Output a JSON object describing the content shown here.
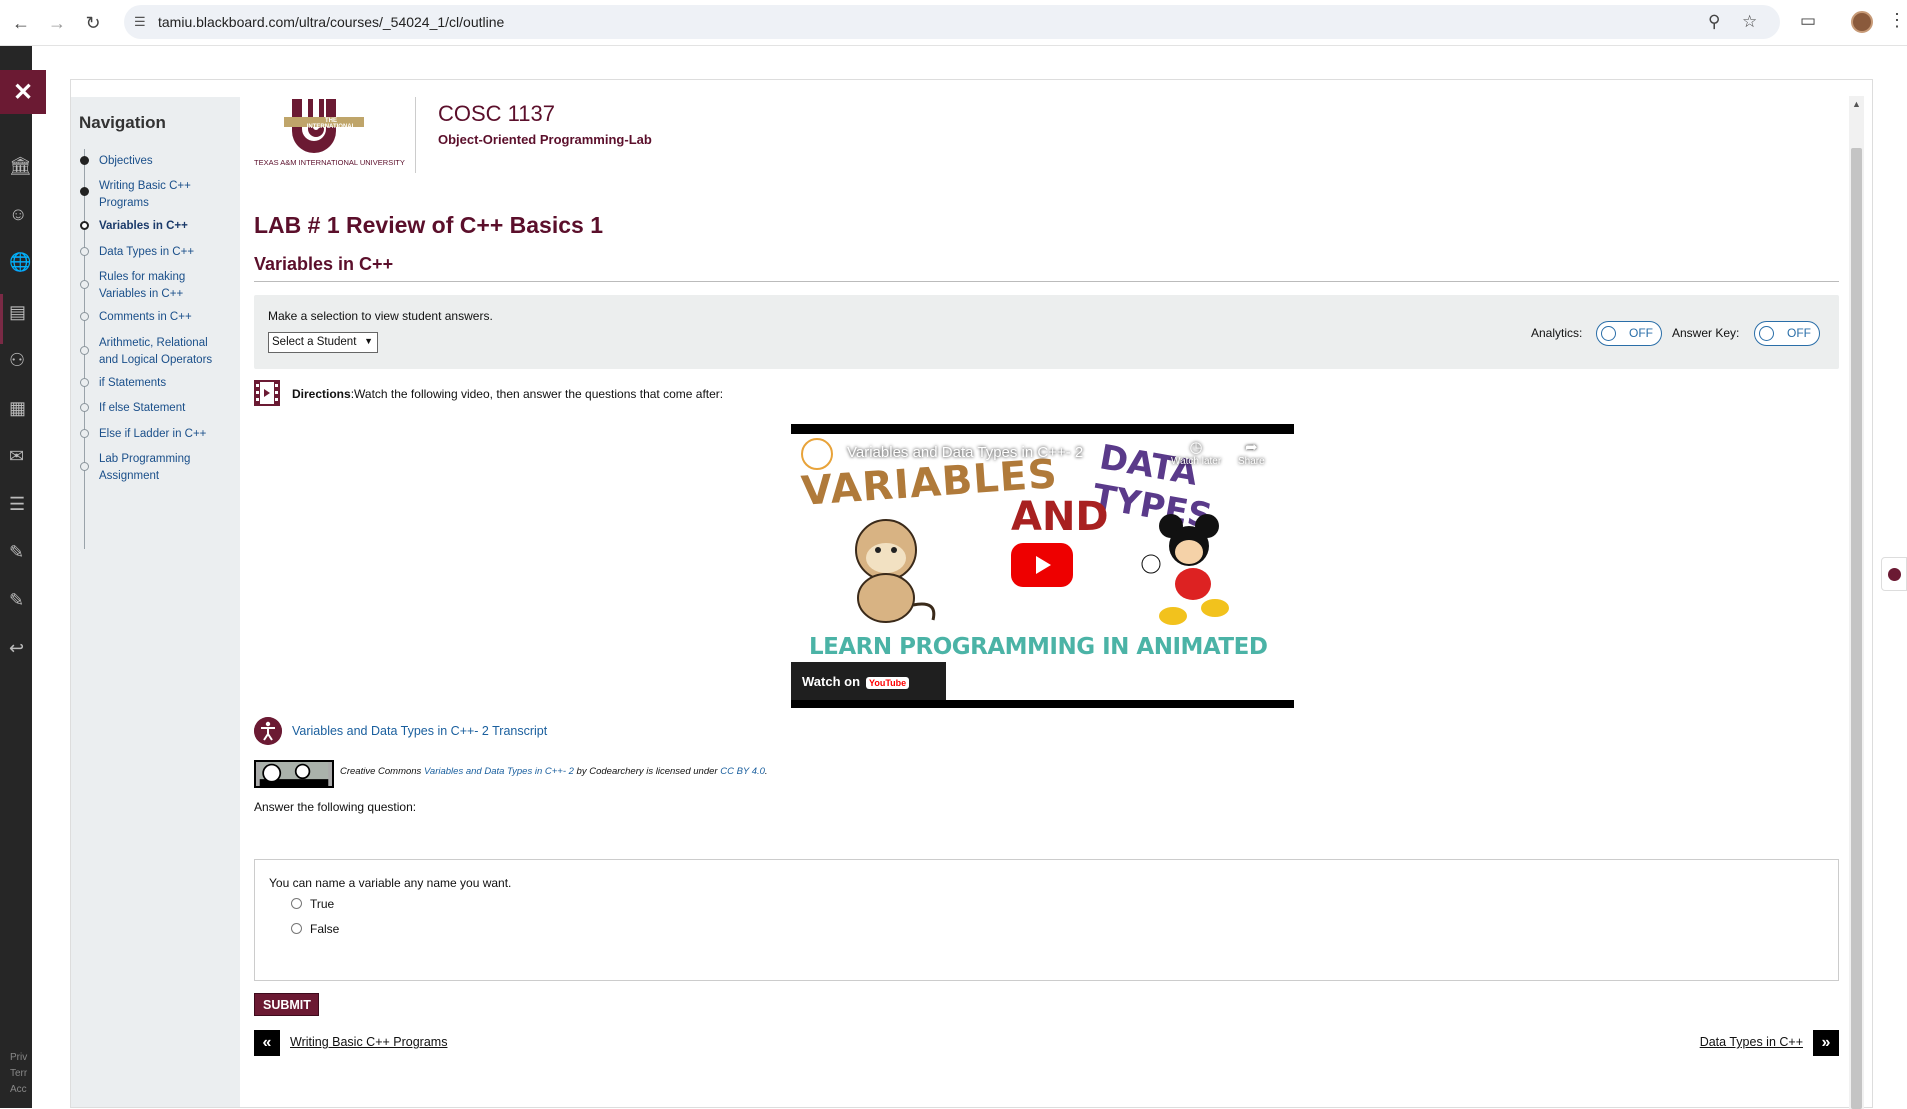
{
  "browser": {
    "url": "tamiu.blackboard.com/ultra/courses/_54024_1/cl/outline"
  },
  "rail": {
    "close_icon": "close-icon",
    "footer_lines": [
      "Priv",
      "Terr",
      "Acc"
    ]
  },
  "navigation": {
    "title": "Navigation",
    "items": [
      {
        "label": "Objectives",
        "state": "done"
      },
      {
        "label": "Writing Basic C++ Programs",
        "state": "done"
      },
      {
        "label": "Variables in C++",
        "state": "current"
      },
      {
        "label": "Data Types in C++",
        "state": "todo"
      },
      {
        "label": "Rules for making Variables in C++",
        "state": "todo"
      },
      {
        "label": "Comments in C++",
        "state": "todo"
      },
      {
        "label": "Arithmetic, Relational and Logical Operators",
        "state": "todo"
      },
      {
        "label": "if Statements",
        "state": "todo"
      },
      {
        "label": "If else Statement",
        "state": "todo"
      },
      {
        "label": "Else if Ladder in C++",
        "state": "todo"
      },
      {
        "label": "Lab Programming Assignment",
        "state": "todo"
      }
    ]
  },
  "header": {
    "logo_top": "THE INTERNATIONAL",
    "logo_text": "TEXAS A&M INTERNATIONAL UNIVERSITY",
    "course_code": "COSC 1137",
    "course_name": "Object-Oriented Programming-Lab"
  },
  "main": {
    "lab_title": "LAB # 1 Review of C++ Basics 1",
    "section_title": "Variables in C++",
    "student_prompt": "Make a selection to view student answers.",
    "student_select": "Select a Student",
    "analytics_label": "Analytics:",
    "analytics_value": "OFF",
    "answer_key_label": "Answer Key:",
    "answer_key_value": "OFF",
    "directions_bold": "Directions",
    "directions_text": ":Watch the following video, then answer the questions that come after:",
    "video": {
      "title": "Variables and Data Types in C++- 2",
      "word_variables": "VARIABLES",
      "word_and": "AND",
      "word_datatypes": "DATA TYPES",
      "tagline": "LEARN PROGRAMMING IN ANIMATED WAY",
      "watch_later": "Watch later",
      "share": "Share",
      "watch_on": "Watch on",
      "youtube": "YouTube"
    },
    "transcript_link": "Variables and Data Types in C++- 2 Transcript",
    "cc": {
      "prefix": "Creative Commons ",
      "work": "Variables and Data Types in C++- 2",
      "middle": " by Codearchery is licensed under ",
      "license": "CC BY 4.0",
      "suffix": "."
    },
    "ask_text": "Answer the following question:",
    "question": {
      "text": "You can name a variable any name you want.",
      "options": [
        "True",
        "False"
      ]
    },
    "submit_label": "SUBMIT",
    "prev_label": "Writing Basic C++ Programs",
    "next_label": "Data Types in C++"
  },
  "colors": {
    "maroon": "#5b0f2b",
    "link": "#1a5f9e",
    "toggle": "#2a6ea8"
  }
}
